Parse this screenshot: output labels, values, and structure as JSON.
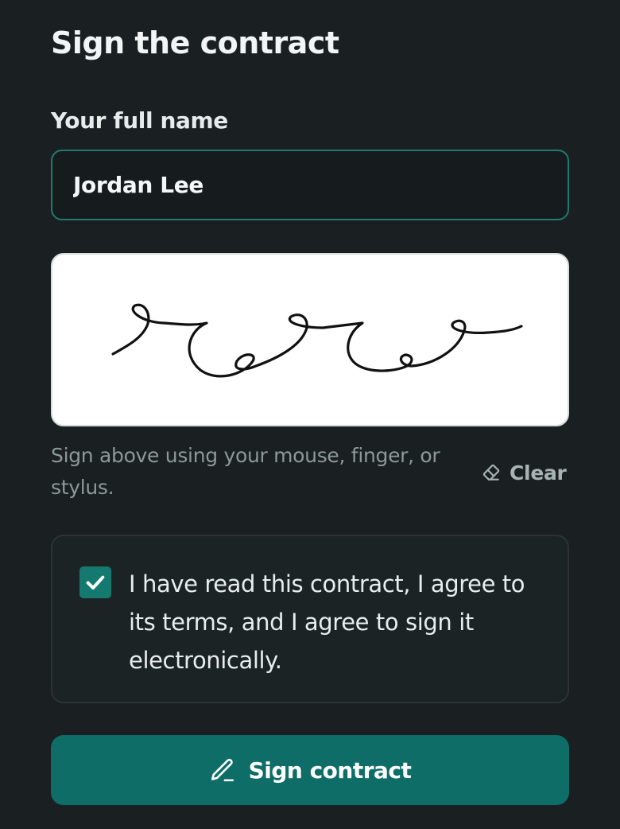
{
  "form": {
    "title": "Sign the contract",
    "name_label": "Your full name",
    "name_value": "Jordan Lee",
    "signature_hint": "Sign above using your mouse, finger, or stylus.",
    "clear_label": "Clear",
    "consent_checked": true,
    "consent_text": "I have read this contract, I agree to its terms, and I agree to sign it electronically.",
    "submit_label": "Sign contract"
  },
  "icons": {
    "clear": "eraser-icon",
    "checkbox": "check-icon",
    "submit": "pen-icon"
  },
  "colors": {
    "background": "#1a2021",
    "accent": "#0f6d67",
    "input_border": "#1f7a71",
    "checkbox": "#147a70",
    "signature_ink": "#111111"
  }
}
